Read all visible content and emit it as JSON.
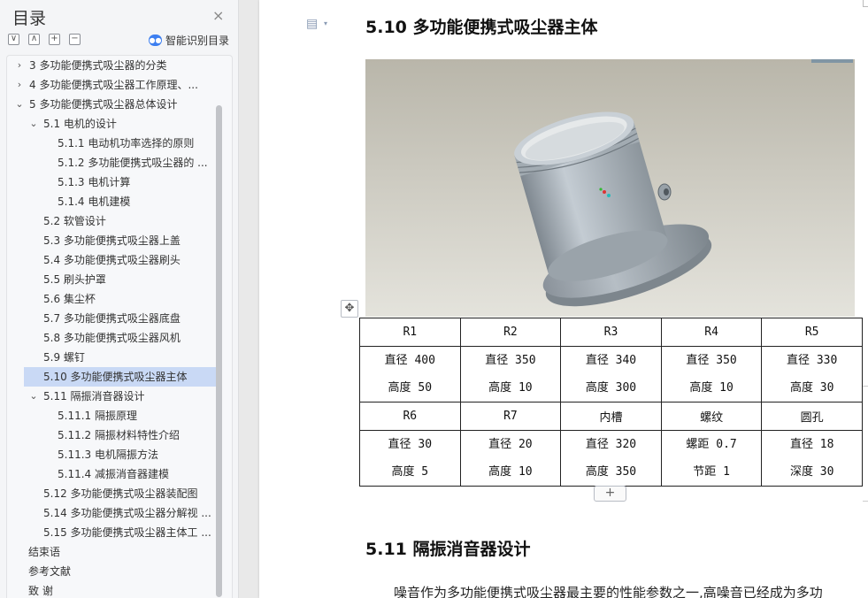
{
  "sidebar": {
    "title": "目录",
    "close": "×",
    "tools": [
      "∨",
      "∧",
      "+",
      "−"
    ],
    "smart_toc_label": "智能识别目录",
    "items": [
      {
        "label": "3 多功能便携式吸尘器的分类",
        "level": 1,
        "chevron": "›"
      },
      {
        "label": "4 多功能便携式吸尘器工作原理、...",
        "level": 1,
        "chevron": "›"
      },
      {
        "label": "5 多功能便携式吸尘器总体设计",
        "level": 1,
        "chevron": "⌄"
      },
      {
        "label": "5.1 电机的设计",
        "level": 2,
        "chevron": "⌄"
      },
      {
        "label": "5.1.1 电动机功率选择的原则",
        "level": 3,
        "chevron": ""
      },
      {
        "label": "5.1.2 多功能便携式吸尘器的 ...",
        "level": 3,
        "chevron": ""
      },
      {
        "label": "5.1.3 电机计算",
        "level": 3,
        "chevron": ""
      },
      {
        "label": "5.1.4 电机建模",
        "level": 3,
        "chevron": ""
      },
      {
        "label": "5.2 软管设计",
        "level": 2,
        "chevron": ""
      },
      {
        "label": "5.3 多功能便携式吸尘器上盖",
        "level": 2,
        "chevron": ""
      },
      {
        "label": "5.4 多功能便携式吸尘器刷头",
        "level": 2,
        "chevron": ""
      },
      {
        "label": "5.5 刷头护罩",
        "level": 2,
        "chevron": ""
      },
      {
        "label": "5.6 集尘杯",
        "level": 2,
        "chevron": ""
      },
      {
        "label": "5.7 多功能便携式吸尘器底盘",
        "level": 2,
        "chevron": ""
      },
      {
        "label": "5.8 多功能便携式吸尘器风机",
        "level": 2,
        "chevron": ""
      },
      {
        "label": "5.9 螺钉",
        "level": 2,
        "chevron": ""
      },
      {
        "label": "5.10 多功能便携式吸尘器主体",
        "level": 2,
        "chevron": "",
        "selected": true
      },
      {
        "label": "5.11 隔振消音器设计",
        "level": 2,
        "chevron": "⌄"
      },
      {
        "label": "5.11.1 隔振原理",
        "level": 3,
        "chevron": ""
      },
      {
        "label": "5.11.2 隔振材料特性介绍",
        "level": 3,
        "chevron": ""
      },
      {
        "label": "5.11.3 电机隔振方法",
        "level": 3,
        "chevron": ""
      },
      {
        "label": "5.11.4 减振消音器建模",
        "level": 3,
        "chevron": ""
      },
      {
        "label": "5.12 多功能便携式吸尘器装配图",
        "level": 2,
        "chevron": ""
      },
      {
        "label": "5.14 多功能便携式吸尘器分解视 ...",
        "level": 2,
        "chevron": ""
      },
      {
        "label": "5.15 多功能便携式吸尘器主体工 ...",
        "level": 2,
        "chevron": ""
      },
      {
        "label": "结束语",
        "level": 0,
        "chevron": ""
      },
      {
        "label": "参考文献",
        "level": 0,
        "chevron": ""
      },
      {
        "label": "致   谢",
        "level": 0,
        "chevron": ""
      }
    ]
  },
  "document": {
    "heading_510": "5.10 多功能便携式吸尘器主体",
    "heading_511": "5.11 隔振消音器设计",
    "paragraph_start": "噪音作为多功能便携式吸尘器最主要的性能参数之一,高噪音已经成为多功",
    "add_row_label": "+",
    "table": {
      "rows": [
        {
          "kind": "h",
          "cells": [
            "R1",
            "R2",
            "R3",
            "R4",
            "R5"
          ]
        },
        {
          "kind": "v",
          "cells": [
            [
              "直径 400",
              "高度 50"
            ],
            [
              "直径 350",
              "高度 10"
            ],
            [
              "直径 340",
              "高度 300"
            ],
            [
              "直径 350",
              "高度 10"
            ],
            [
              "直径 330",
              "高度 30"
            ]
          ]
        },
        {
          "kind": "h",
          "cells": [
            "R6",
            "R7",
            "内槽",
            "螺纹",
            "圆孔"
          ]
        },
        {
          "kind": "v",
          "cells": [
            [
              "直径 30",
              "高度 5"
            ],
            [
              "直径 20",
              "高度 10"
            ],
            [
              "直径 320",
              "高度 350"
            ],
            [
              "螺距 0.7",
              "节距 1"
            ],
            [
              "直径 18",
              "深度 30"
            ]
          ]
        }
      ]
    }
  }
}
